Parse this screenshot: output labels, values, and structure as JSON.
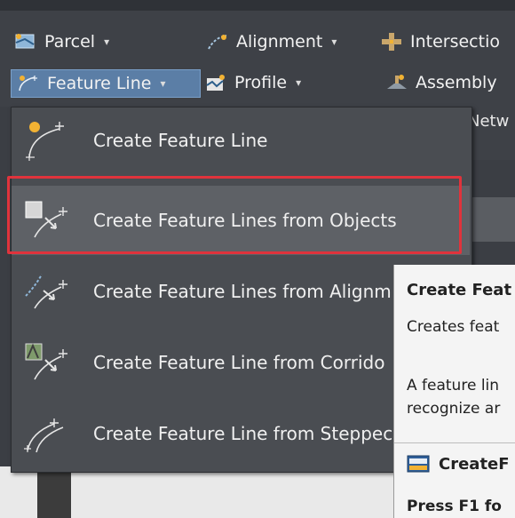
{
  "ribbon": {
    "parcel_label": "Parcel",
    "alignment_label": "Alignment",
    "intersections_label": "Intersectio",
    "feature_line_label": "Feature Line",
    "profile_label": "Profile",
    "assembly_label": "Assembly",
    "network_partial": "Netw",
    "caret": "▾"
  },
  "menu": {
    "items": [
      {
        "label": "Create Feature Line"
      },
      {
        "label": "Create Feature Lines from Objects"
      },
      {
        "label": "Create Feature Lines from Alignm"
      },
      {
        "label": "Create Feature Line from Corrido"
      },
      {
        "label": "Create Feature Line from Steppec"
      }
    ]
  },
  "tooltip": {
    "title": "Create Feat",
    "line1": "Creates feat",
    "line2": "A feature lin",
    "line3": "recognize ar",
    "command": "CreateF",
    "press": "Press F1 fo"
  },
  "colors": {
    "accent_highlight": "#e0333c",
    "menu_bg": "#4a4d52",
    "ribbon_bg": "#3e4147"
  }
}
